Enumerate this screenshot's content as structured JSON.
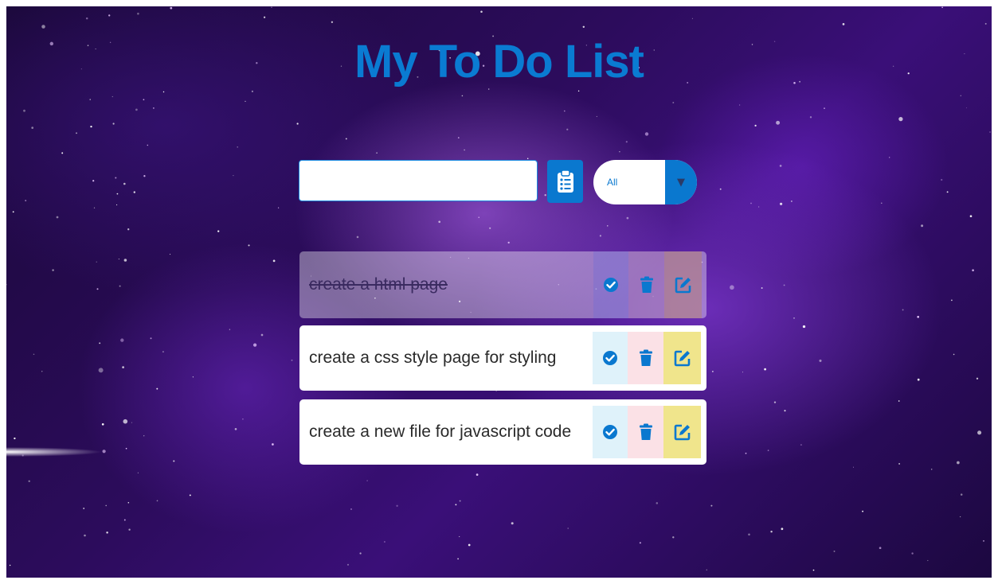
{
  "header": {
    "title": "My To Do List"
  },
  "form": {
    "input_value": "",
    "add_icon": "clipboard-list-icon",
    "filter": {
      "selected": "All",
      "arrow": "▼"
    }
  },
  "todos": [
    {
      "text": "create a html page",
      "completed": true
    },
    {
      "text": "create a css style page for styling",
      "completed": false
    },
    {
      "text": "create a new file for javascript code",
      "completed": false
    }
  ],
  "icons": {
    "complete": "check-circle-icon",
    "delete": "trash-icon",
    "edit": "edit-icon"
  },
  "colors": {
    "accent": "#0a78cf",
    "complete_bg": "#dff2fa",
    "trash_bg": "#fbe1e6",
    "edit_bg": "#f0e58c"
  }
}
